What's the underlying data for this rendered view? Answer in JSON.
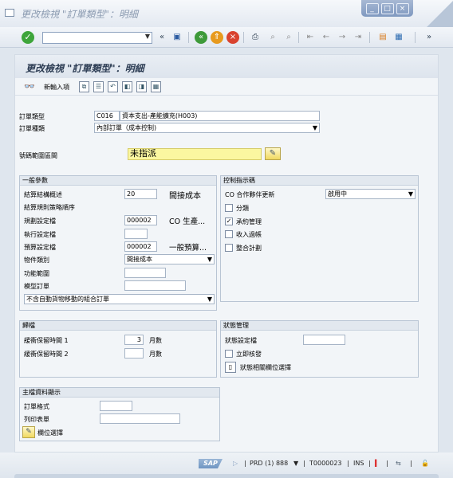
{
  "window": {
    "title": "更改檢視 \"訂單類型\"：明細",
    "controls": [
      "_",
      "□",
      "×"
    ]
  },
  "std_toolbar": {
    "command_value": "",
    "icons": [
      "enter-icon",
      "back-icon",
      "save-icon",
      "prev-icon",
      "exit-icon",
      "cancel-icon",
      "print-icon",
      "find-icon",
      "find-next-icon",
      "first-page-icon",
      "prev-page-icon",
      "next-page-icon",
      "last-page-icon",
      "new-session-icon",
      "shortcut-icon",
      "more-icon"
    ]
  },
  "page": {
    "title": "更改檢視 \"訂單類型\"：明細",
    "new_entries_label": "新輸入項"
  },
  "header": {
    "order_type_label": "訂單類型",
    "order_type_code": "C016",
    "order_type_desc": "資本支出-產能擴充(H003)",
    "order_category_label": "訂單種類",
    "order_category_value": "內部訂單（成本控制)",
    "number_range_label": "號碼範圍區間",
    "number_range_value": "未指派"
  },
  "general": {
    "title": "一般參數",
    "settlement_profile_label": "結算結構概述",
    "settlement_profile_value": "20",
    "settlement_profile_text": "間接成本",
    "settlement_rule_label": "結算規則策略順序",
    "planning_profile_label": "規劃設定檔",
    "planning_profile_value": "000002",
    "planning_profile_text": "CO 生產...",
    "execution_profile_label": "執行設定檔",
    "execution_profile_value": "",
    "budget_profile_label": "預算設定檔",
    "budget_profile_value": "000002",
    "budget_profile_text": "一般預算...",
    "object_class_label": "物件類別",
    "object_class_value": "間接成本",
    "functional_area_label": "功能範圍",
    "functional_area_value": "",
    "model_order_label": "模型訂單",
    "model_order_value": "",
    "goods_movement_value": "不含自動貨物移動的組合訂單"
  },
  "control": {
    "title": "控制指示碼",
    "co_partner_label": "CO 合作夥伴更新",
    "co_partner_value": "啟用中",
    "classification_label": "分類",
    "classification_checked": false,
    "commitment_label": "承約管理",
    "commitment_checked": true,
    "revenue_label": "收入過帳",
    "revenue_checked": false,
    "integrated_label": "整合計劃",
    "integrated_checked": false
  },
  "archiving": {
    "title": "歸檔",
    "residence1_label": "緩衝保留時間 1",
    "residence1_value": "3",
    "residence1_unit": "月數",
    "residence2_label": "緩衝保留時間 2",
    "residence2_value": "",
    "residence2_unit": "月數"
  },
  "status_mgmt": {
    "title": "狀態管理",
    "status_profile_label": "狀態設定檔",
    "status_profile_value": "",
    "release_label": "立即核發",
    "release_checked": false,
    "field_select_label": "狀態相關欄位選擇"
  },
  "master_data": {
    "title": "主檔資料顯示",
    "order_layout_label": "訂單格式",
    "order_layout_value": "",
    "print_form_label": "列印表單",
    "print_form_value": "",
    "field_select_label": "欄位選擇"
  },
  "statusbar": {
    "logo": "SAP",
    "system": "PRD (1) 888",
    "server": "T0000023",
    "mode": "INS"
  },
  "colors": {
    "highlight_yellow": "#fbf7a0",
    "ok_green": "#3ea53b",
    "title_blue": "#2e3e55"
  }
}
